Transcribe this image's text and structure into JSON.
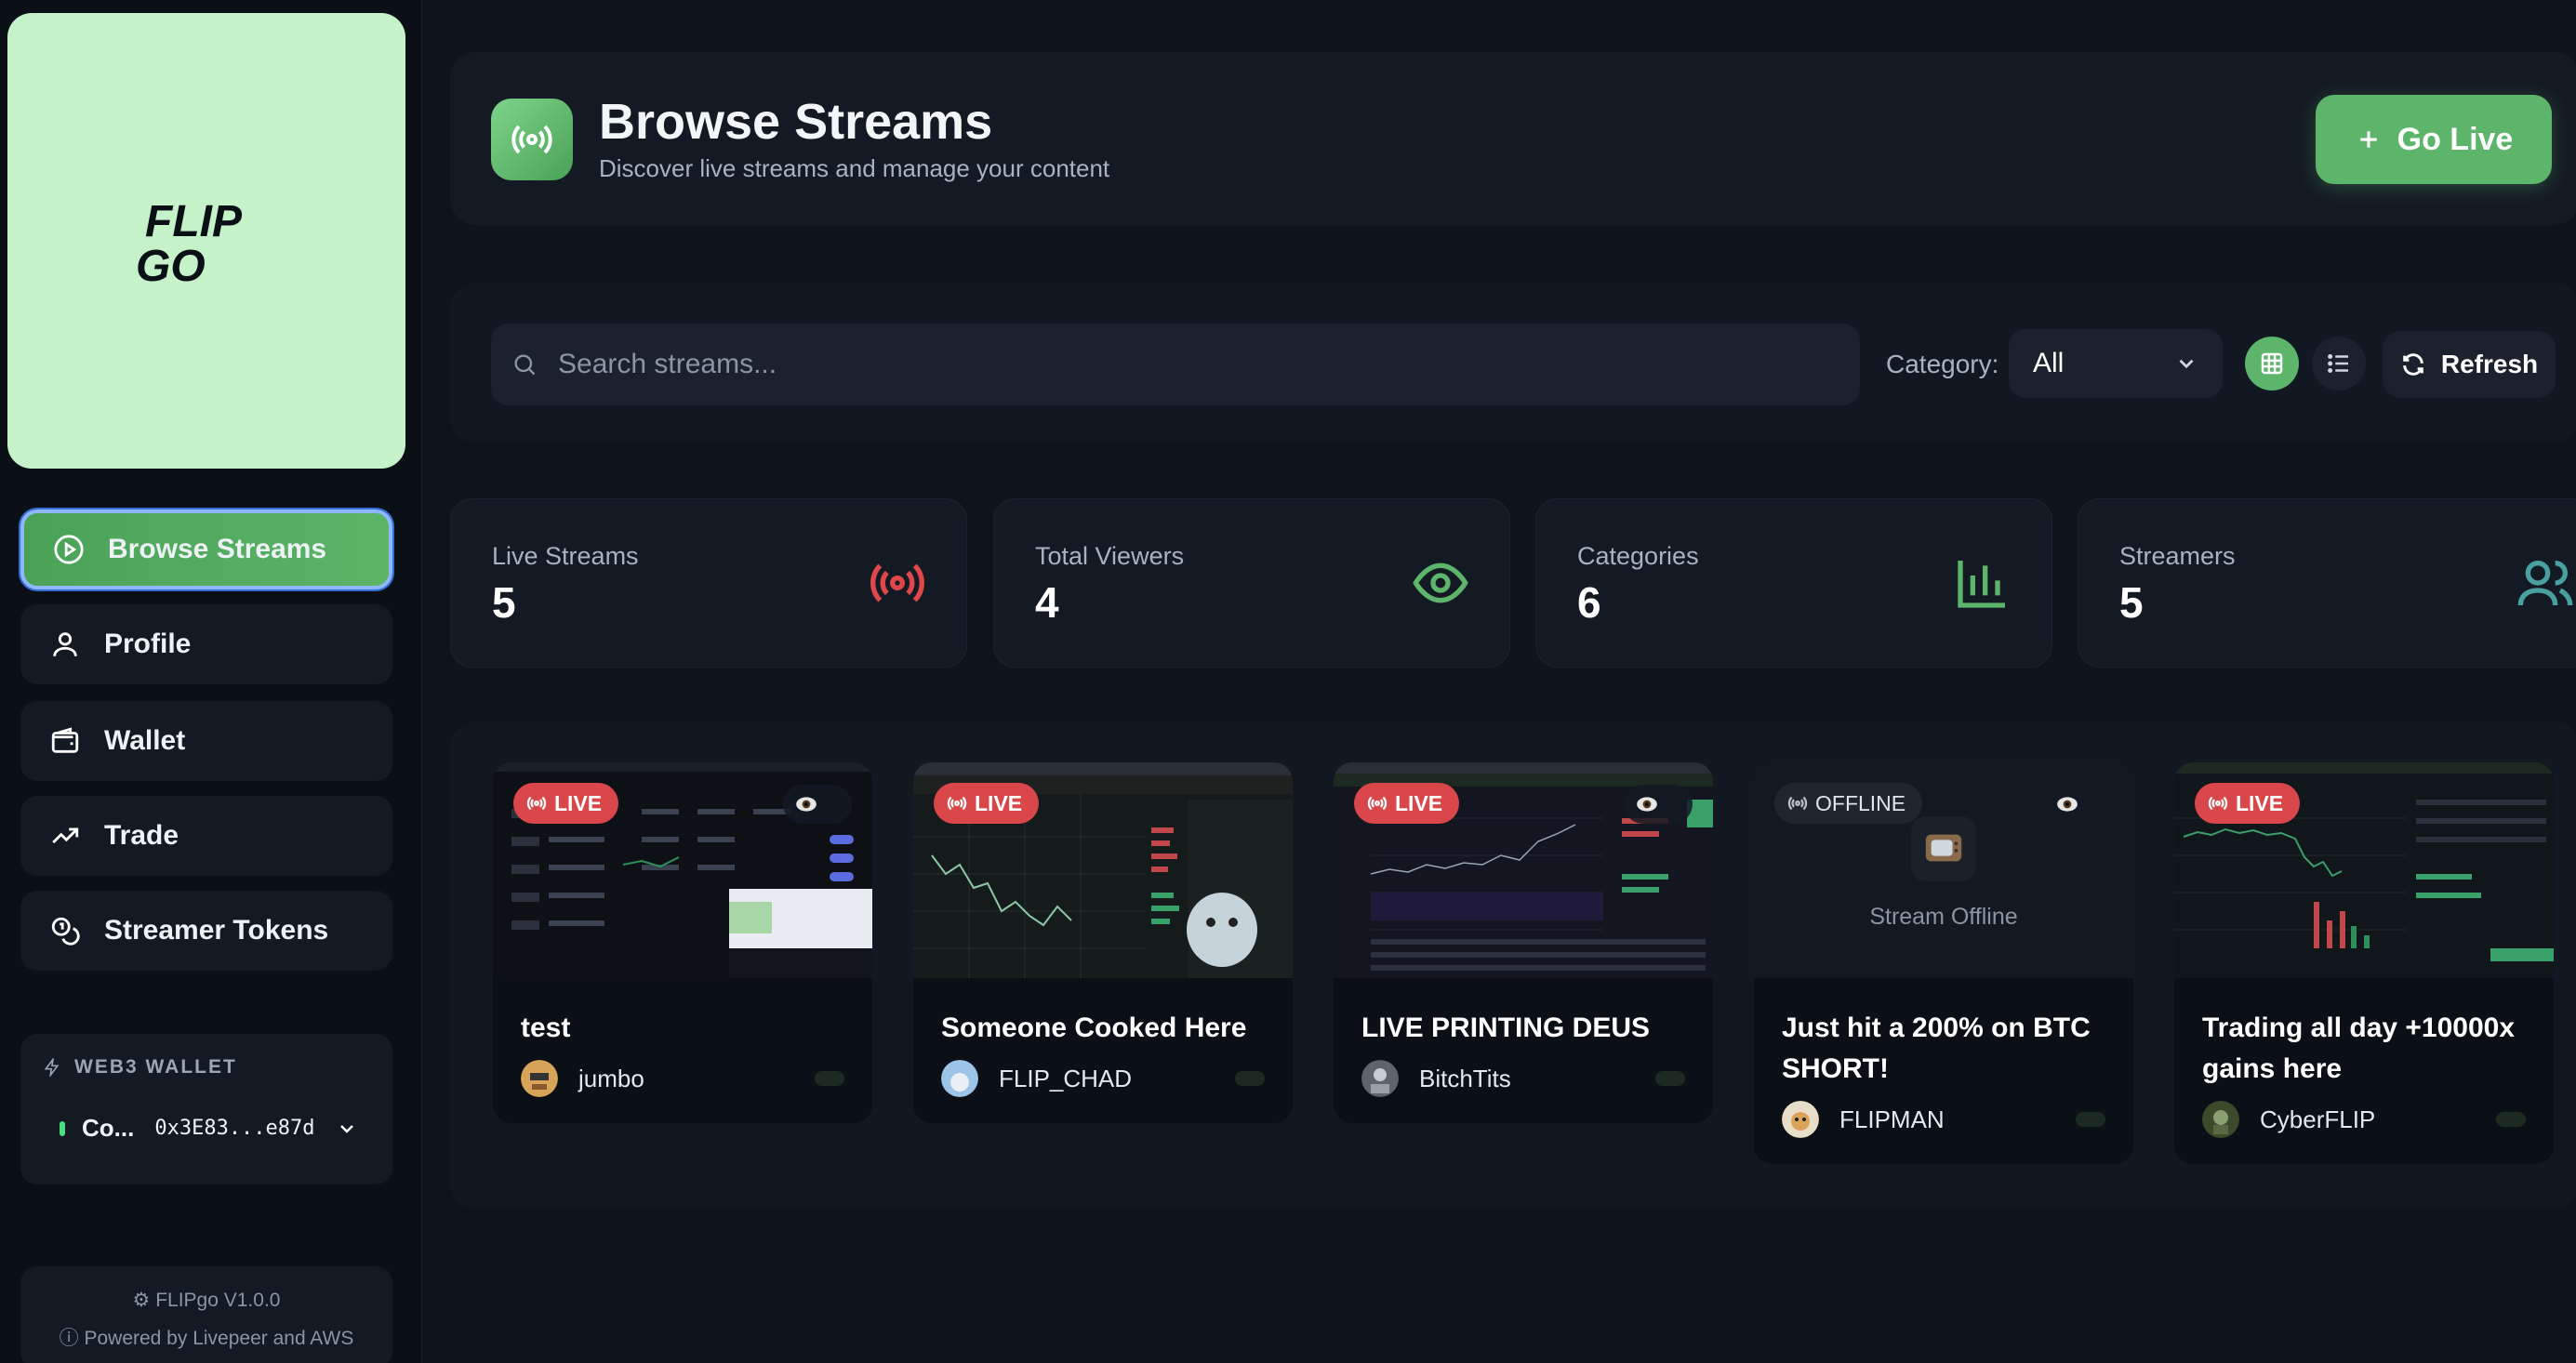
{
  "sidebar": {
    "logo_text_line1": "FLIP",
    "logo_text_line2": "GO",
    "nav": [
      {
        "label": "Browse Streams",
        "icon": "play-circle-icon",
        "active": true
      },
      {
        "label": "Profile",
        "icon": "user-icon"
      },
      {
        "label": "Wallet",
        "icon": "wallet-icon"
      },
      {
        "label": "Trade",
        "icon": "trending-up-icon"
      },
      {
        "label": "Streamer Tokens",
        "icon": "coins-icon"
      }
    ],
    "wallet": {
      "title": "WEB3 WALLET",
      "name": "Co...",
      "address": "0x3E83...e87d",
      "status_color": "#4ade80"
    },
    "footer": {
      "version": "FLIPgo V1.0.0",
      "powered": "Powered by Livepeer and AWS"
    }
  },
  "header": {
    "title": "Browse Streams",
    "subtitle": "Discover live streams and manage your content",
    "go_live_label": "Go Live"
  },
  "filter": {
    "search_placeholder": "Search streams...",
    "category_label": "Category:",
    "category_value": "All",
    "refresh_label": "Refresh",
    "view_mode": "grid"
  },
  "stats": [
    {
      "label": "Live Streams",
      "value": "5",
      "icon": "broadcast-icon",
      "color": "#e0474b"
    },
    {
      "label": "Total Viewers",
      "value": "4",
      "icon": "eye-icon",
      "color": "#5cb56a"
    },
    {
      "label": "Categories",
      "value": "6",
      "icon": "bar-chart-icon",
      "color": "#5cb56a"
    },
    {
      "label": "Streamers",
      "value": "5",
      "icon": "users-icon",
      "color": "#4aa0a0"
    }
  ],
  "streams": [
    {
      "title": "test",
      "user": "jumbo",
      "status": "LIVE"
    },
    {
      "title": "Someone Cooked Here",
      "user": "FLIP_CHAD",
      "status": "LIVE"
    },
    {
      "title": "LIVE PRINTING DEUS",
      "user": "BitchTits",
      "status": "LIVE"
    },
    {
      "title": "Just hit a 200% on BTC SHORT!",
      "user": "FLIPMAN",
      "status": "OFFLINE",
      "offline_text": "Stream Offline"
    },
    {
      "title": "Trading all day +10000x gains here",
      "user": "CyberFLIP",
      "status": "LIVE"
    }
  ],
  "colors": {
    "accent": "#5cb56a",
    "live": "#d9474a",
    "logo_bg": "#c5f2c9"
  }
}
